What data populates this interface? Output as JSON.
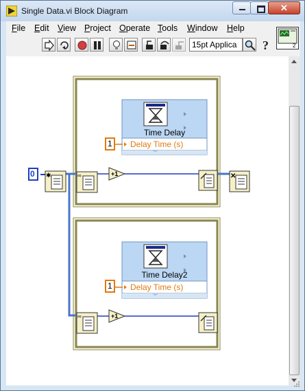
{
  "window": {
    "title": "Single Data.vi Block Diagram"
  },
  "menu": {
    "items": [
      {
        "label": "File",
        "u": "F",
        "rest": "ile"
      },
      {
        "label": "Edit",
        "u": "E",
        "rest": "dit"
      },
      {
        "label": "View",
        "u": "V",
        "rest": "iew"
      },
      {
        "label": "Project",
        "u": "P",
        "rest": "roject"
      },
      {
        "label": "Operate",
        "u": "O",
        "rest": "perate"
      },
      {
        "label": "Tools",
        "u": "T",
        "rest": "ools"
      },
      {
        "label": "Window",
        "u": "W",
        "rest": "indow"
      },
      {
        "label": "Help",
        "u": "H",
        "rest": "elp"
      }
    ]
  },
  "toolbar": {
    "font_label": "15pt Applica"
  },
  "diagram": {
    "constant_zero": "0",
    "node1": {
      "title": "Time Delay",
      "input": "Delay Time (s)",
      "const": "1"
    },
    "node2": {
      "title": "Time Delay2",
      "input": "Delay Time (s)",
      "const": "1"
    },
    "increment_label": "+1"
  },
  "colors": {
    "wire_blue": "#1f3fbf",
    "frame_yellow": "#f3efc4",
    "node_blue": "#bcd7f3",
    "orange": "#e07a10"
  }
}
